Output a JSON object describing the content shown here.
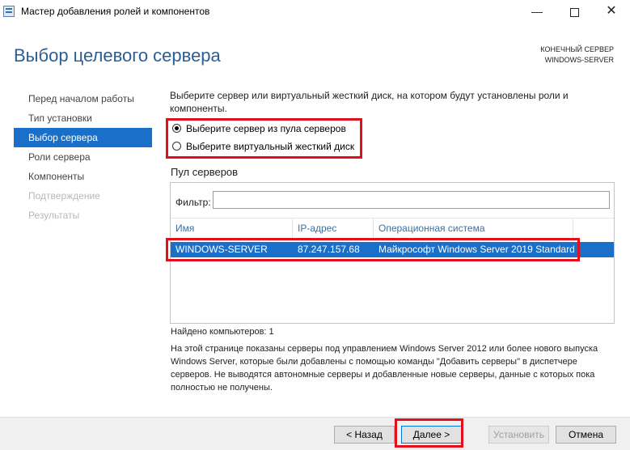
{
  "window": {
    "title": "Мастер добавления ролей и компонентов",
    "minimize_icon": "minimize-icon",
    "maximize_icon": "maximize-icon",
    "close_icon": "close-icon"
  },
  "header": {
    "page_title": "Выбор целевого сервера",
    "destination_label": "КОНЕЧНЫЙ СЕРВЕР",
    "destination_server": "WINDOWS-SERVER"
  },
  "nav": {
    "items": [
      {
        "label": "Перед началом работы",
        "state": "normal"
      },
      {
        "label": "Тип установки",
        "state": "normal"
      },
      {
        "label": "Выбор сервера",
        "state": "active"
      },
      {
        "label": "Роли сервера",
        "state": "normal"
      },
      {
        "label": "Компоненты",
        "state": "normal"
      },
      {
        "label": "Подтверждение",
        "state": "disabled"
      },
      {
        "label": "Результаты",
        "state": "disabled"
      }
    ]
  },
  "main": {
    "description": "Выберите сервер или виртуальный жесткий диск, на котором будут установлены роли и компоненты.",
    "options": [
      {
        "label": "Выберите сервер из пула серверов",
        "checked": true
      },
      {
        "label": "Выберите виртуальный жесткий диск",
        "checked": false
      }
    ],
    "pool_title": "Пул серверов",
    "filter_label": "Фильтр:",
    "filter_value": "",
    "columns": [
      "Имя",
      "IP-адрес",
      "Операционная система"
    ],
    "rows": [
      {
        "name": "WINDOWS-SERVER",
        "ip": "87.247.157.68",
        "os": "Майкрософт Windows Server 2019 Standard",
        "selected": true
      }
    ],
    "found_text": "Найдено компьютеров: 1",
    "info_text": "На этой странице показаны серверы под управлением Windows Server 2012 или более нового выпуска Windows Server, которые были добавлены с помощью команды \"Добавить серверы\" в диспетчере серверов. Не выводятся автономные серверы и добавленные новые серверы, данные с которых пока полностью не получены."
  },
  "footer": {
    "back_label": "< Назад",
    "next_label": "Далее >",
    "install_label": "Установить",
    "cancel_label": "Отмена"
  },
  "colors": {
    "accent": "#1a6fc9",
    "title_blue": "#2b5f93",
    "highlight_red": "#e0101c"
  }
}
